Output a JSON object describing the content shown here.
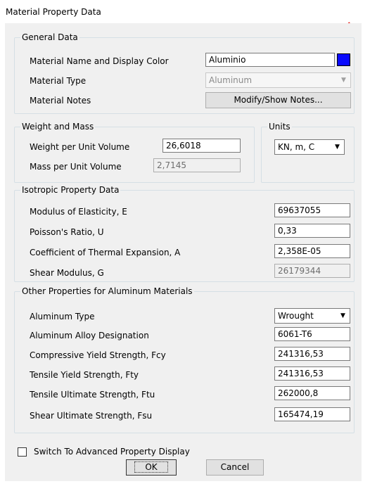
{
  "window": {
    "title": "Material Property Data"
  },
  "general": {
    "legend": "General Data",
    "name_label": "Material Name and Display Color",
    "name_value": "Aluminio",
    "display_color": "#0a0aff",
    "type_label": "Material Type",
    "type_value": "Aluminum",
    "notes_label": "Material Notes",
    "notes_button": "Modify/Show Notes..."
  },
  "weight": {
    "legend": "Weight and Mass",
    "weight_label": "Weight per Unit Volume",
    "weight_value": "26,6018",
    "mass_label": "Mass per Unit Volume",
    "mass_value": "2,7145"
  },
  "units": {
    "legend": "Units",
    "value": "KN, m, C"
  },
  "isotropic": {
    "legend": "Isotropic Property Data",
    "rows": [
      {
        "label": "Modulus of Elasticity,  E",
        "value": "69637055"
      },
      {
        "label": "Poisson's Ratio,  U",
        "value": "0,33"
      },
      {
        "label": "Coefficient of Thermal Expansion,  A",
        "value": "2,358E-05"
      },
      {
        "label": "Shear Modulus,  G",
        "value": "26179344"
      }
    ]
  },
  "aluminum": {
    "legend": "Other Properties for Aluminum Materials",
    "type_label": "Aluminum Type",
    "type_value": "Wrought",
    "rows": [
      {
        "label": "Aluminum Alloy Designation",
        "value": "6061-T6"
      },
      {
        "label": "Compressive Yield Strength, Fcy",
        "value": "241316,53"
      },
      {
        "label": "Tensile Yield Strength, Fty",
        "value": "241316,53"
      },
      {
        "label": "Tensile Ultimate Strength, Ftu",
        "value": "262000,8"
      },
      {
        "label": "Shear Ultimate Strength, Fsu",
        "value": "165474,19"
      }
    ]
  },
  "footer": {
    "checkbox_label": "Switch To Advanced Property Display",
    "ok_label": "OK",
    "cancel_label": "Cancel"
  },
  "annotation": {
    "arrow_color": "#e8231f"
  }
}
